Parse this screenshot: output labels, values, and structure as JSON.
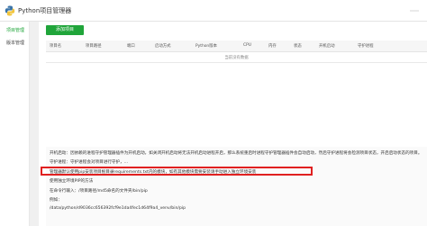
{
  "app": {
    "title": "Python项目管理器"
  },
  "sidebar": {
    "items": [
      {
        "label": "项目管理"
      },
      {
        "label": "版本管理"
      }
    ]
  },
  "main": {
    "add_button": "添加项目",
    "table": {
      "headers": [
        "项目名",
        "项目路径",
        "端口",
        "启动方式",
        "Python版本",
        "CPU",
        "内存",
        "状态",
        "开机启动",
        "守护进程"
      ],
      "empty_text": "当前没有数据"
    }
  },
  "info": {
    "lines": [
      "开机启动：因依赖的进程守护管理器插件为开机启动，如关闭开机启动将无法开机启动进程开启，那么系统重启时进程守护管理器插件会自动启动，然后守护进程将会检测项目状态，开启启动状态的项目。",
      "守护进程：守护进程会对项目进行守护，...",
      "管理器默认使用pip安装项目根目录requirements.txt内的模块，如有其他模块需要安装请手动进入独立环境安装",
      "使用独立环境PIP的方法",
      "在命令行输入：/项目路径/md5命名的文件夹/bin/pip",
      "例如：",
      "/data/python/d9036cc656392fcf9e1da4fec1d64f9a4_venv/bin/pip"
    ]
  }
}
